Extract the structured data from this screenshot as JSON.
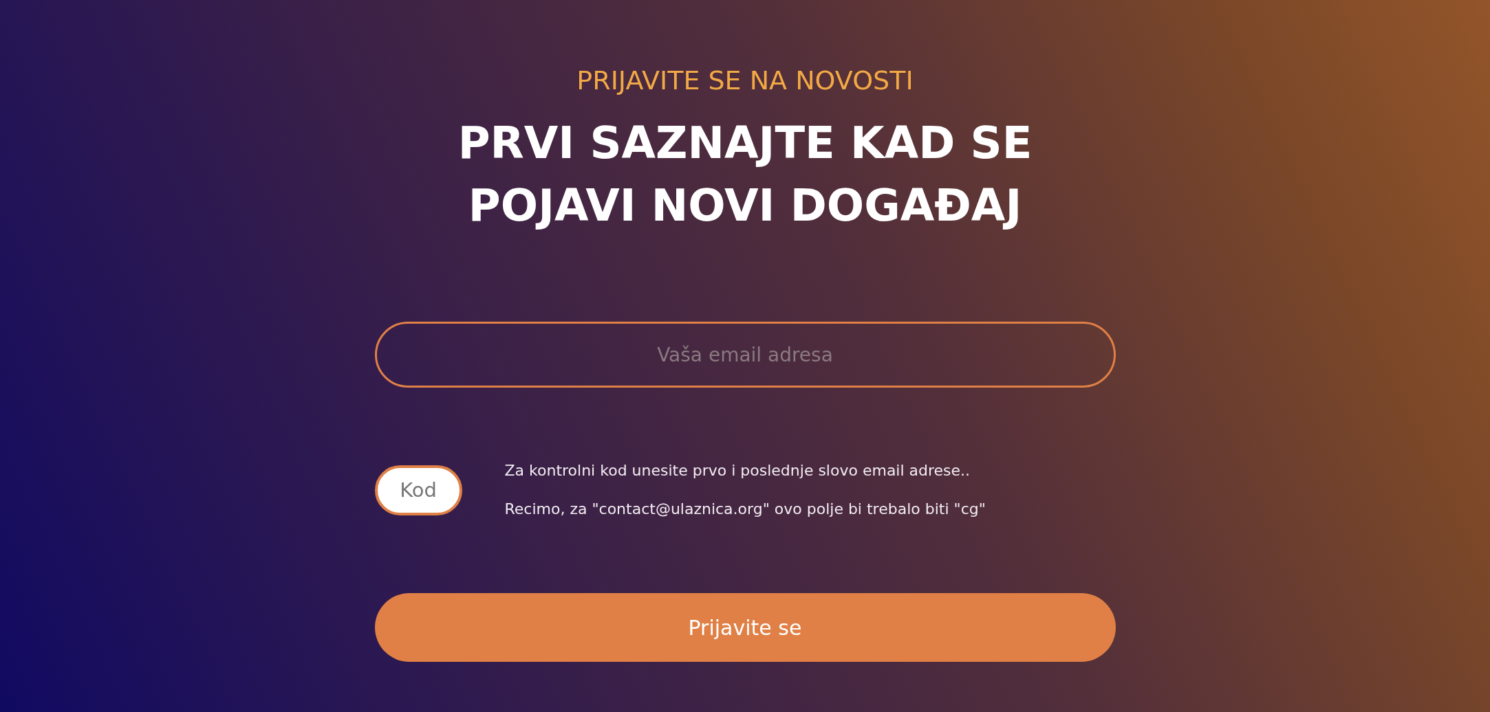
{
  "eyebrow": "PRIJAVITE SE NA NOVOSTI",
  "heading": "PRVI SAZNAJTE KAD SE POJAVI NOVI DOGAĐAJ",
  "email_field": {
    "placeholder": "Vaša email adresa"
  },
  "code_field": {
    "placeholder": "Kod"
  },
  "help_lines": [
    "Za kontrolni kod unesite prvo i poslednje slovo email adrese..",
    "Recimo, za \"contact@ulaznica.org\" ovo polje bi trebalo biti \"cg\""
  ],
  "submit_button": "Prijavite se"
}
